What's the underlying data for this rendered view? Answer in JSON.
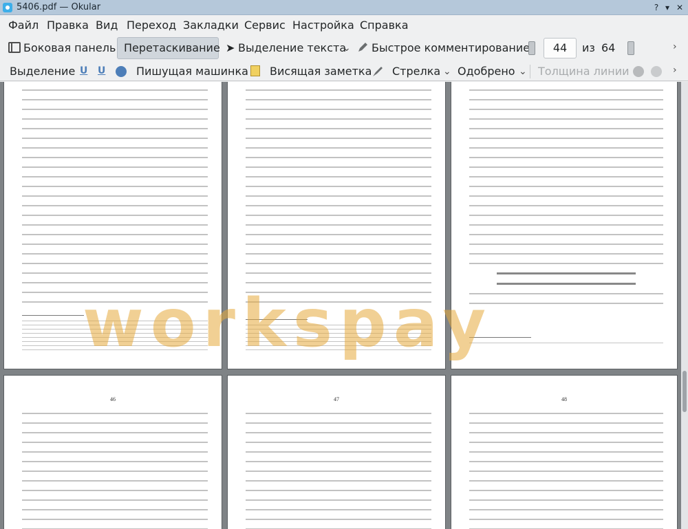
{
  "window": {
    "title": "5406.pdf — Okular"
  },
  "menu": [
    "Файл",
    "Правка",
    "Вид",
    "Переход",
    "Закладки",
    "Сервис",
    "Настройка",
    "Справка"
  ],
  "toolbar": {
    "sidebar_label": "Боковая панель",
    "drag_label": "Перетаскивание",
    "text_select_label": "Выделение текста",
    "quick_annot_label": "Быстрое комментирование",
    "page_current": "44",
    "page_of_label": "из",
    "page_total": "64"
  },
  "annot_toolbar": {
    "highlight_label": "Выделение",
    "underline1": "U",
    "underline2": "U",
    "typewriter_label": "Пишущая машинка",
    "note_label": "Висящая заметка",
    "arrow_label": "Стрелка",
    "stamp_label": "Одобрено",
    "line_width_label": "Толщина линии"
  },
  "pages": {
    "p46": "46",
    "p47": "47",
    "p48": "48"
  },
  "watermark": "workspay",
  "colors": {
    "titlebar": "#b5c8da",
    "viewport": "#7f8386",
    "accent": "#3daee9",
    "watermark": "#e6aa3c"
  }
}
